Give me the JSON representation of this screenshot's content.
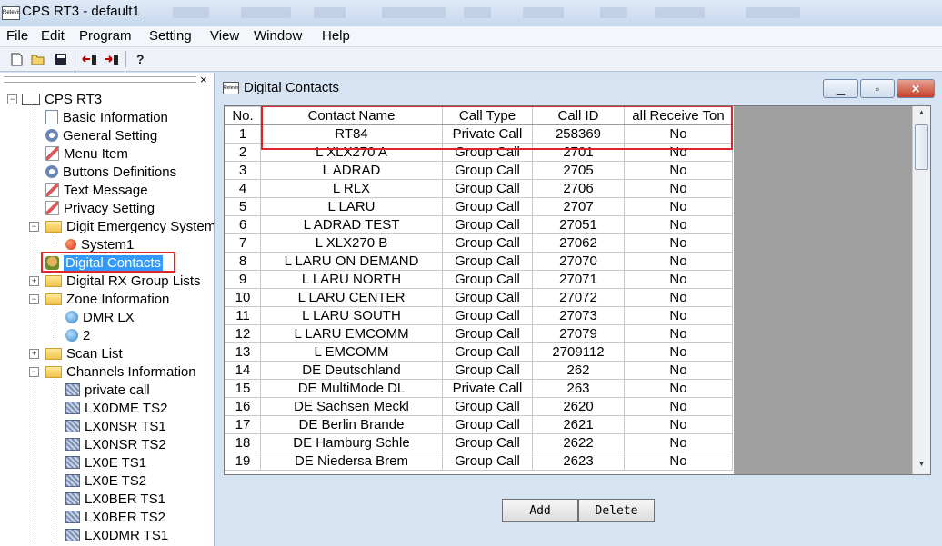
{
  "window": {
    "title": "CPS RT3 - default1",
    "app_icon_text": "Retevis"
  },
  "menu": [
    "File",
    "Edit",
    "Program",
    "Setting",
    "View",
    "Window",
    "Help"
  ],
  "toolbar": {
    "new": "new-icon",
    "open": "open-icon",
    "save": "save-icon",
    "read": "read-radio-icon",
    "write": "write-radio-icon",
    "help": "help-icon"
  },
  "tree": {
    "close_glyph": "×",
    "root": "CPS RT3",
    "items": [
      {
        "label": "Basic Information",
        "icon": "doc-icon"
      },
      {
        "label": "General Setting",
        "icon": "gear-icon"
      },
      {
        "label": "Menu Item",
        "icon": "menu-icon"
      },
      {
        "label": "Buttons Definitions",
        "icon": "buttons-icon"
      },
      {
        "label": "Text Message",
        "icon": "message-icon"
      },
      {
        "label": "Privacy Setting",
        "icon": "privacy-icon"
      },
      {
        "label": "Digit Emergency System",
        "icon": "folder-icon"
      },
      {
        "label": "System1",
        "icon": "emergency-icon"
      },
      {
        "label": "Digital Contacts",
        "icon": "contacts-icon"
      },
      {
        "label": "Digital RX Group Lists",
        "icon": "folder-icon"
      },
      {
        "label": "Zone Information",
        "icon": "folder-icon"
      },
      {
        "label": "DMR LX",
        "icon": "zone-icon"
      },
      {
        "label": "2",
        "icon": "zone-icon"
      },
      {
        "label": "Scan List",
        "icon": "folder-icon"
      },
      {
        "label": "Channels Information",
        "icon": "folder-icon"
      },
      {
        "label": "private call",
        "icon": "channel-icon"
      },
      {
        "label": "LX0DME TS2",
        "icon": "channel-icon"
      },
      {
        "label": "LX0NSR TS1",
        "icon": "channel-icon"
      },
      {
        "label": "LX0NSR TS2",
        "icon": "channel-icon"
      },
      {
        "label": "LX0E TS1",
        "icon": "channel-icon"
      },
      {
        "label": "LX0E TS2",
        "icon": "channel-icon"
      },
      {
        "label": "LX0BER TS1",
        "icon": "channel-icon"
      },
      {
        "label": "LX0BER TS2",
        "icon": "channel-icon"
      },
      {
        "label": "LX0DMR TS1",
        "icon": "channel-icon"
      }
    ]
  },
  "contacts_window": {
    "title": "Digital Contacts",
    "icon_text": "Retevis",
    "columns": [
      "No.",
      "Contact Name",
      "Call Type",
      "Call ID",
      "all Receive Ton"
    ],
    "rows": [
      [
        "1",
        "RT84",
        "Private Call",
        "258369",
        "No"
      ],
      [
        "2",
        "L XLX270 A",
        "Group Call",
        "2701",
        "No"
      ],
      [
        "3",
        "L ADRAD",
        "Group Call",
        "2705",
        "No"
      ],
      [
        "4",
        "L RLX",
        "Group Call",
        "2706",
        "No"
      ],
      [
        "5",
        "L LARU",
        "Group Call",
        "2707",
        "No"
      ],
      [
        "6",
        "L ADRAD TEST",
        "Group Call",
        "27051",
        "No"
      ],
      [
        "7",
        "L XLX270 B",
        "Group Call",
        "27062",
        "No"
      ],
      [
        "8",
        "L LARU ON DEMAND",
        "Group Call",
        "27070",
        "No"
      ],
      [
        "9",
        "L LARU NORTH",
        "Group Call",
        "27071",
        "No"
      ],
      [
        "10",
        "L LARU CENTER",
        "Group Call",
        "27072",
        "No"
      ],
      [
        "11",
        "L LARU SOUTH",
        "Group Call",
        "27073",
        "No"
      ],
      [
        "12",
        "L LARU EMCOMM",
        "Group Call",
        "27079",
        "No"
      ],
      [
        "13",
        "L EMCOMM",
        "Group Call",
        "2709112",
        "No"
      ],
      [
        "14",
        "DE Deutschland",
        "Group Call",
        "262",
        "No"
      ],
      [
        "15",
        "DE MultiMode DL",
        "Private Call",
        "263",
        "No"
      ],
      [
        "16",
        "DE Sachsen Meckl",
        "Group Call",
        "2620",
        "No"
      ],
      [
        "17",
        "DE Berlin Brande",
        "Group Call",
        "2621",
        "No"
      ],
      [
        "18",
        "DE Hamburg Schle",
        "Group Call",
        "2622",
        "No"
      ],
      [
        "19",
        "DE Niedersa Brem",
        "Group Call",
        "2623",
        "No"
      ]
    ],
    "add_label": "Add",
    "delete_label": "Delete"
  },
  "colors": {
    "highlight_box": "#e0242c",
    "selection": "#3399ff"
  }
}
